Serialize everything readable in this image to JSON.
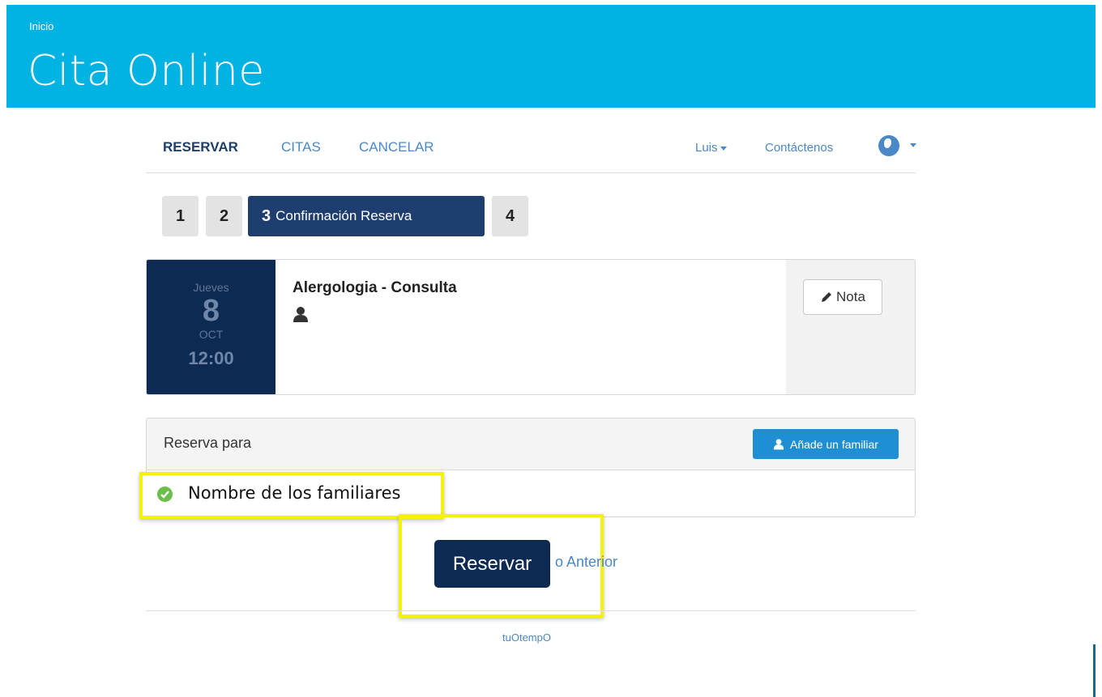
{
  "header": {
    "home_link": "Inicio",
    "title": "Cita Online",
    "background_color": "#00b3e3"
  },
  "nav": {
    "items": [
      "RESERVAR",
      "CITAS",
      "CANCELAR"
    ],
    "active": "RESERVAR",
    "user_menu": "Luis",
    "contact": "Contáctenos",
    "language_icon": "globe-icon"
  },
  "steps": {
    "items": [
      "1",
      "2",
      "3",
      "4"
    ],
    "active_label": "Confirmación Reserva",
    "active_index": 3
  },
  "appointment": {
    "day_of_week": "Jueves",
    "day": "8",
    "month": "OCT",
    "time": "12:00",
    "service": "Alergologia - Consulta",
    "note_button": "Nota"
  },
  "booking_for": {
    "title": "Reserva para",
    "add_family_button": "Añade un familiar",
    "family_member": "Nombre de los familiares"
  },
  "actions": {
    "submit": "Reservar",
    "back": "o Anterior"
  },
  "footer": {
    "brand": "tuOtempO"
  },
  "colors": {
    "primary_dark": "#0d2a53",
    "link": "#4a88c8",
    "highlight": "#f4f20a",
    "success": "#6cbf4a"
  }
}
